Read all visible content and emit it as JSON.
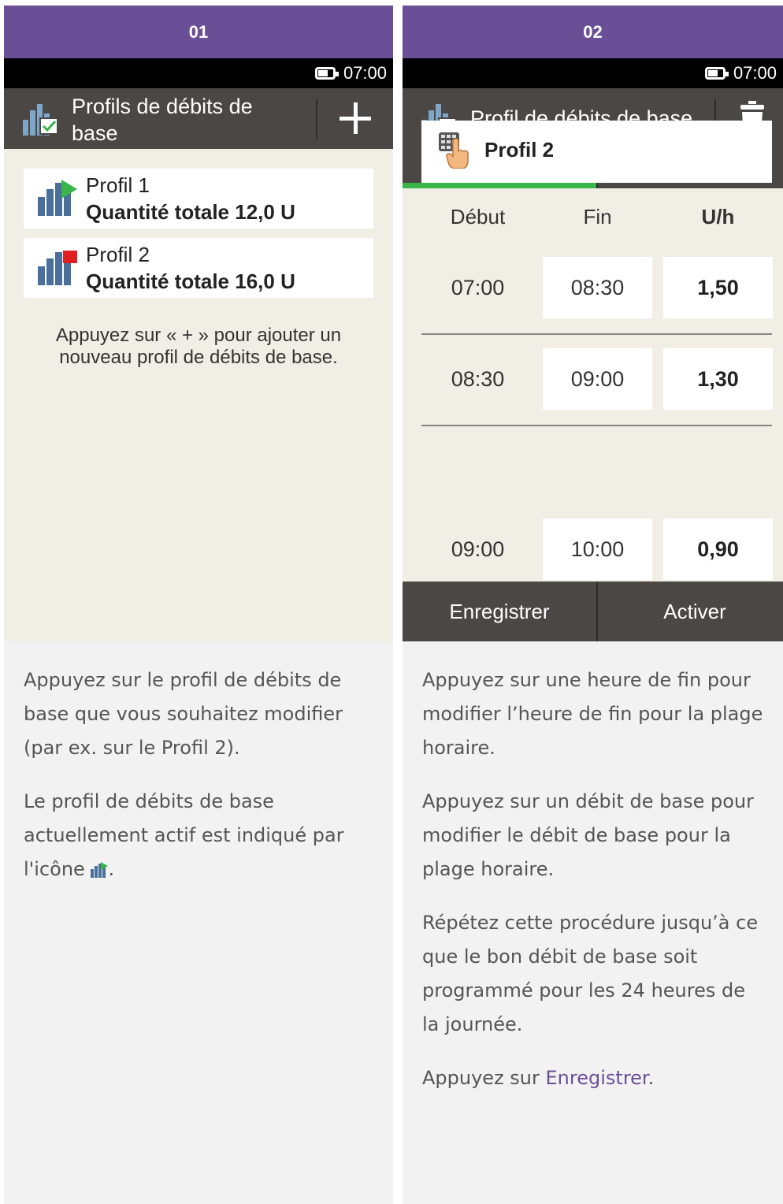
{
  "panel1": {
    "step": "01",
    "status_time": "07:00",
    "title": "Profils de débits de base",
    "profiles": [
      {
        "name": "Profil 1",
        "quantity": "Quantité totale 12,0 U",
        "marker": "active-flag"
      },
      {
        "name": "Profil 2",
        "quantity": "Quantité totale 16,0 U",
        "marker": "inactive-flag"
      }
    ],
    "hint": "Appuyez sur « + » pour ajouter un nouveau profil de débits de base.",
    "description": [
      "Appuyez sur le profil de débits de base que vous souhaitez modifier (par ex. sur le Profil 2).",
      "Le profil de débits de base actuellement actif est indiqué par l'icône",
      "."
    ]
  },
  "panel2": {
    "step": "02",
    "status_time": "07:00",
    "title": "Profil de débits de base",
    "profile_name": "Profil 2",
    "columns": {
      "start": "Début",
      "end": "Fin",
      "rate": "U/h"
    },
    "rows": [
      {
        "start": "07:00",
        "end": "08:30",
        "rate": "1,50"
      },
      {
        "start": "08:30",
        "end": "09:00",
        "rate": "1,30"
      },
      {
        "start": "09:00",
        "end": "10:00",
        "rate": "0,90"
      }
    ],
    "buttons": {
      "save": "Enregistrer",
      "activate": "Activer"
    },
    "description": [
      "Appuyez sur une heure de fin pour modifier l’heure de fin pour la plage horaire.",
      "Appuyez sur un débit de base pour modifier le débit de base pour la plage horaire.",
      "Répétez cette procédure jusqu’à ce que le bon débit de base soit programmé pour les 24 heures de la journée."
    ],
    "final_prefix": "Appuyez sur ",
    "final_link": "Enregistrer",
    "final_suffix": "."
  },
  "colors": {
    "header": "#6b4f96",
    "titlebar": "#4b4744",
    "screen_bg": "#f1eee5",
    "tab_active": "#39b54a",
    "link": "#6b4f96"
  }
}
